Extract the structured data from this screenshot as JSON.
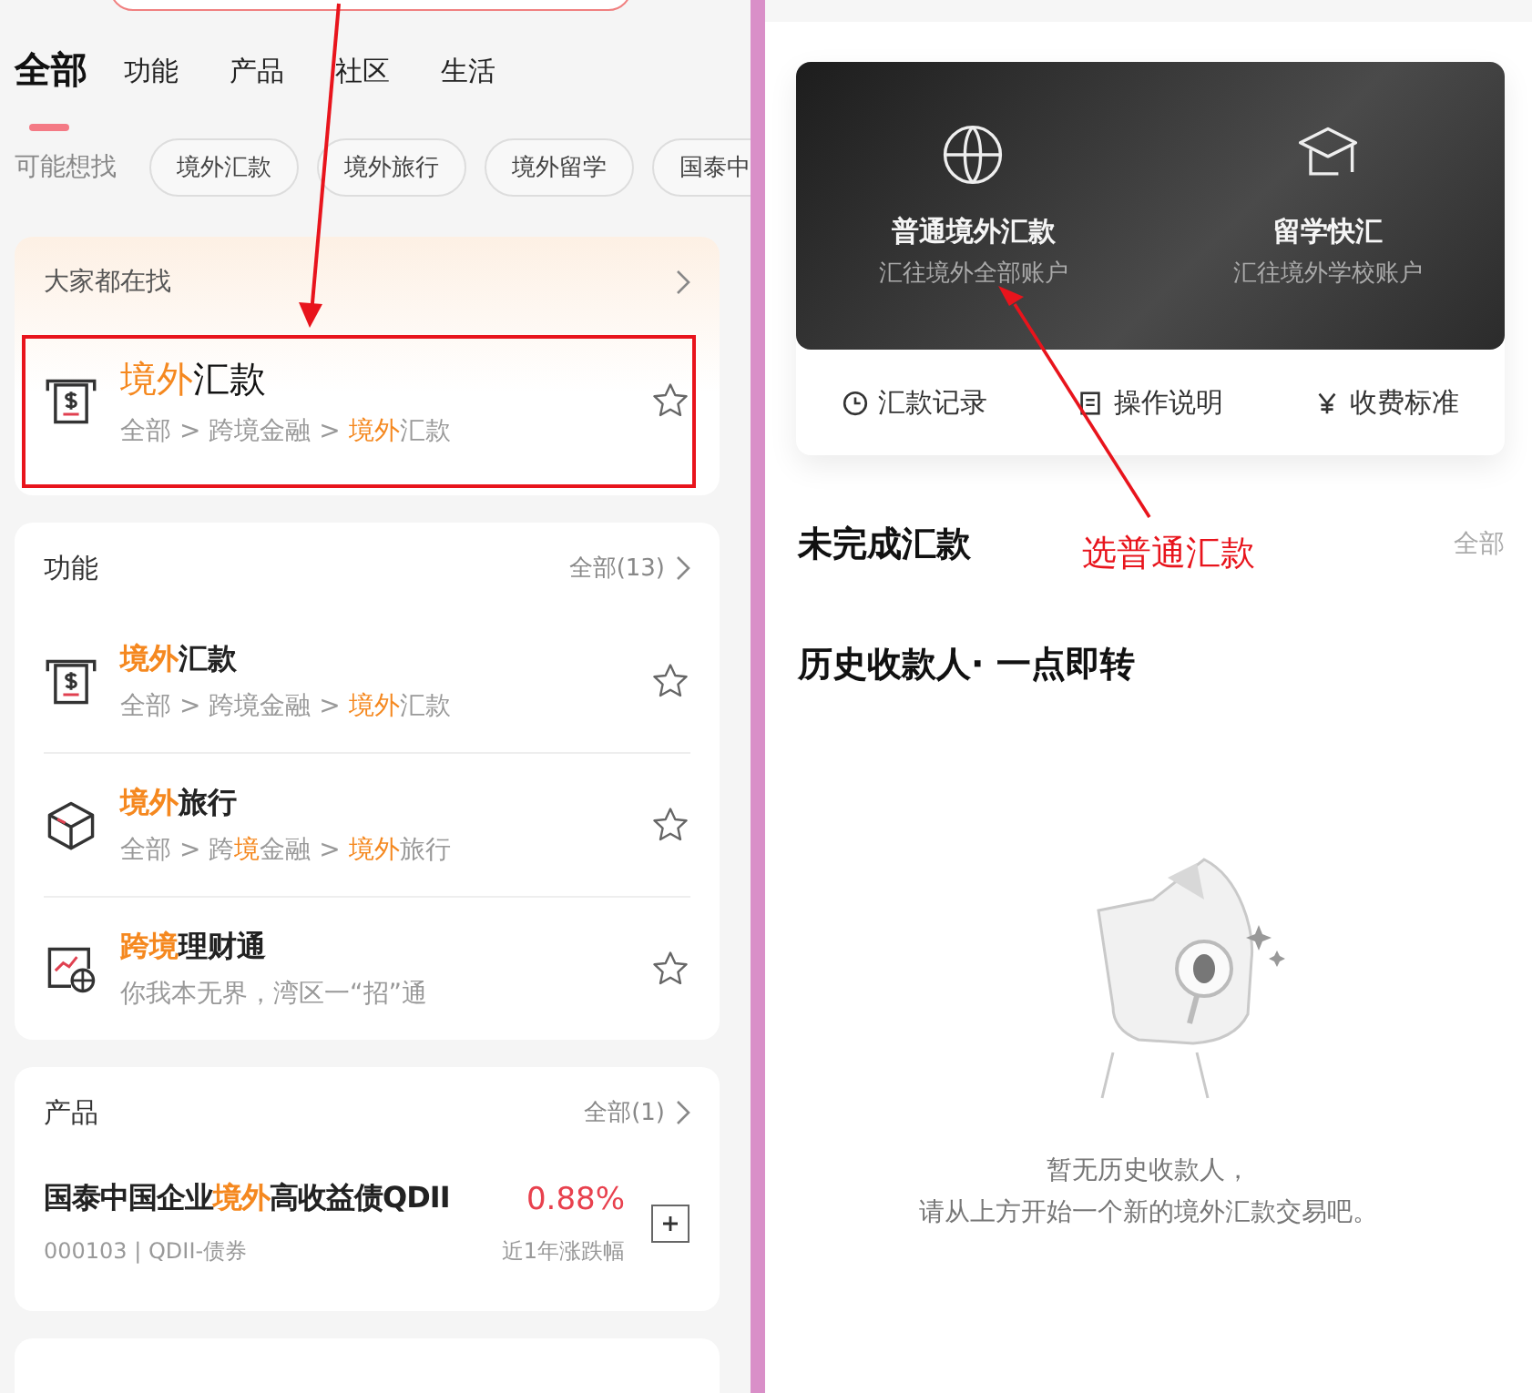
{
  "left": {
    "tabs": [
      {
        "label": "全部",
        "selected": true
      },
      {
        "label": "功能",
        "selected": false
      },
      {
        "label": "产品",
        "selected": false
      },
      {
        "label": "社区",
        "selected": false
      },
      {
        "label": "生活",
        "selected": false
      }
    ],
    "suggest": {
      "label": "可能想找",
      "chips": [
        "境外汇款",
        "境外旅行",
        "境外留学",
        "国泰中"
      ]
    },
    "hot": {
      "title": "大家都在找",
      "item": {
        "kind": "remit",
        "title": [
          {
            "t": "境外",
            "hl": true
          },
          {
            "t": "汇款",
            "hl": false
          }
        ],
        "path": [
          {
            "t": "全部 > 跨境金融 > ",
            "hl": false
          },
          {
            "t": "境外",
            "hl": true
          },
          {
            "t": "汇款",
            "hl": false
          }
        ]
      }
    },
    "functions": {
      "title": "功能",
      "more": "全部(13)",
      "items": [
        {
          "kind": "remit",
          "title": [
            {
              "t": "境外",
              "hl": true
            },
            {
              "t": "汇款",
              "hl": false
            }
          ],
          "path": [
            {
              "t": "全部 > 跨境金融 > ",
              "hl": false
            },
            {
              "t": "境外",
              "hl": true
            },
            {
              "t": "汇款",
              "hl": false
            }
          ]
        },
        {
          "kind": "cube",
          "title": [
            {
              "t": "境外",
              "hl": true
            },
            {
              "t": "旅行",
              "hl": false
            }
          ],
          "path": [
            {
              "t": "全部 > 跨",
              "hl": false
            },
            {
              "t": "境",
              "hl": true
            },
            {
              "t": "金融 > ",
              "hl": false
            },
            {
              "t": "境外",
              "hl": true
            },
            {
              "t": "旅行",
              "hl": false
            }
          ]
        },
        {
          "kind": "chart-globe",
          "title": [
            {
              "t": "跨境",
              "hl": true
            },
            {
              "t": "理财通",
              "hl": false
            }
          ],
          "path": [
            {
              "t": "你我本无界，湾区一“招”通",
              "hl": false
            }
          ]
        }
      ]
    },
    "products": {
      "title": "产品",
      "more": "全部(1)",
      "items": [
        {
          "name": [
            {
              "t": "国泰中国企业",
              "hl": false
            },
            {
              "t": "境外",
              "hl": true
            },
            {
              "t": "高收益债QDII",
              "hl": false
            }
          ],
          "rate": "0.88%",
          "code": "000103 | QDII-债券",
          "rate_label": "近1年涨跌幅"
        }
      ]
    }
  },
  "right": {
    "options": [
      {
        "kind": "globe",
        "title": "普通境外汇款",
        "subtitle": "汇往境外全部账户"
      },
      {
        "kind": "cap",
        "title": "留学快汇",
        "subtitle": "汇往境外学校账户"
      }
    ],
    "links": [
      {
        "kind": "clock",
        "label": "汇款记录"
      },
      {
        "kind": "doc",
        "label": "操作说明"
      },
      {
        "kind": "yen",
        "label": "收费标准"
      }
    ],
    "pending": {
      "title": "未完成汇款",
      "more": "全部"
    },
    "history": {
      "title": "历史收款人· 一点即转"
    },
    "empty": {
      "lines": [
        "暂无历史收款人，",
        "请从上方开始一个新的境外汇款交易吧。"
      ]
    }
  },
  "annotations": {
    "label": "选普通汇款"
  }
}
